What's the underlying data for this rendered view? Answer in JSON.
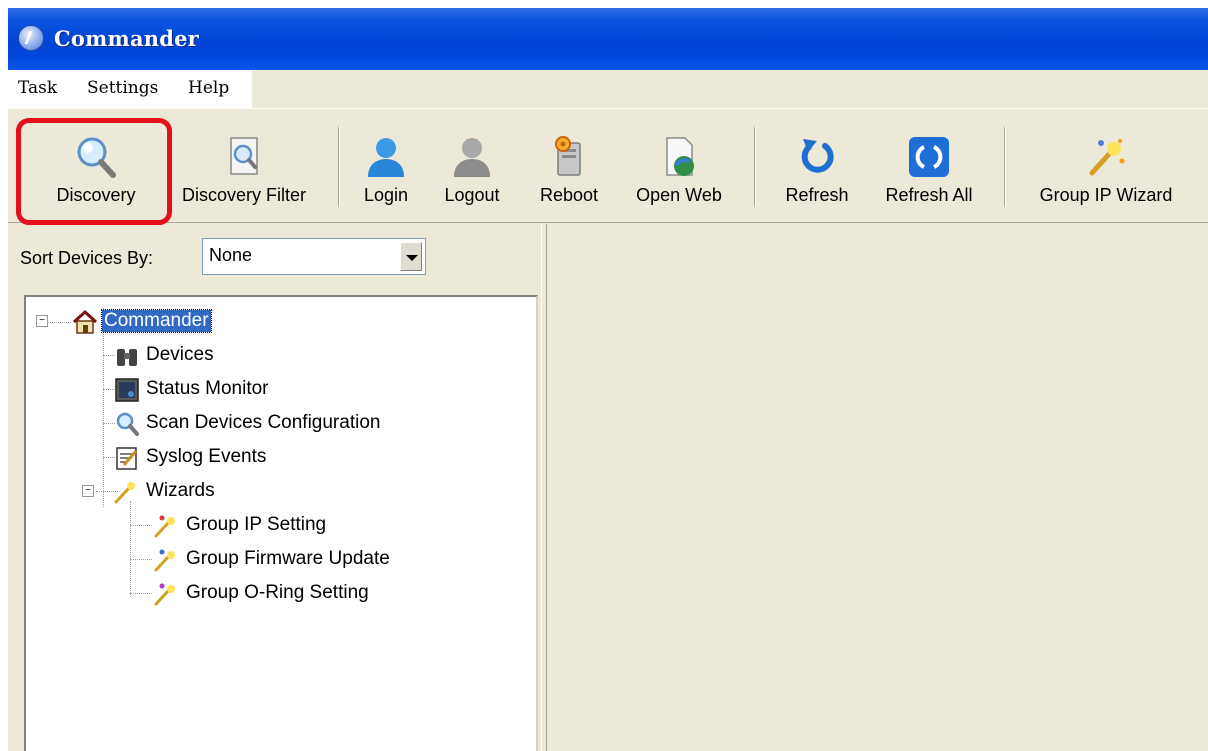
{
  "window": {
    "title": "Commander",
    "app_icon": "commander-app-icon"
  },
  "menu": [
    {
      "label": "Task"
    },
    {
      "label": "Settings"
    },
    {
      "label": "Help"
    }
  ],
  "toolbar": {
    "buttons": [
      {
        "label": "Discovery",
        "icon": "magnifier-icon",
        "highlighted": true
      },
      {
        "label": "Discovery Filter",
        "icon": "filter-document-icon"
      },
      {
        "label": "Login",
        "icon": "user-blue-icon"
      },
      {
        "label": "Logout",
        "icon": "user-gray-icon"
      },
      {
        "label": "Reboot",
        "icon": "reboot-icon"
      },
      {
        "label": "Open Web",
        "icon": "web-page-icon"
      },
      {
        "label": "Refresh",
        "icon": "refresh-icon"
      },
      {
        "label": "Refresh All",
        "icon": "refresh-all-icon"
      },
      {
        "label": "Group IP Wizard",
        "icon": "wizard-wand-icon"
      }
    ],
    "highlight_color": "#e3101b"
  },
  "sort": {
    "label": "Sort Devices By:",
    "value": "None"
  },
  "tree": {
    "root": {
      "label": "Commander",
      "selected": true
    },
    "items": [
      {
        "label": "Devices",
        "icon": "binoculars-icon"
      },
      {
        "label": "Status Monitor",
        "icon": "monitor-icon"
      },
      {
        "label": "Scan Devices Configuration",
        "icon": "magnifier-icon"
      },
      {
        "label": "Syslog Events",
        "icon": "notepad-icon"
      },
      {
        "label": "Wizards",
        "icon": "wand-icon"
      }
    ],
    "wizards": [
      {
        "label": "Group IP Setting",
        "icon": "wand-red-icon"
      },
      {
        "label": "Group Firmware Update",
        "icon": "wand-blue-icon"
      },
      {
        "label": "Group O-Ring Setting",
        "icon": "wand-purple-icon"
      }
    ]
  },
  "colors": {
    "titlebar": "#0046dc",
    "selection": "#316ac5",
    "window": "#ece9d8"
  }
}
